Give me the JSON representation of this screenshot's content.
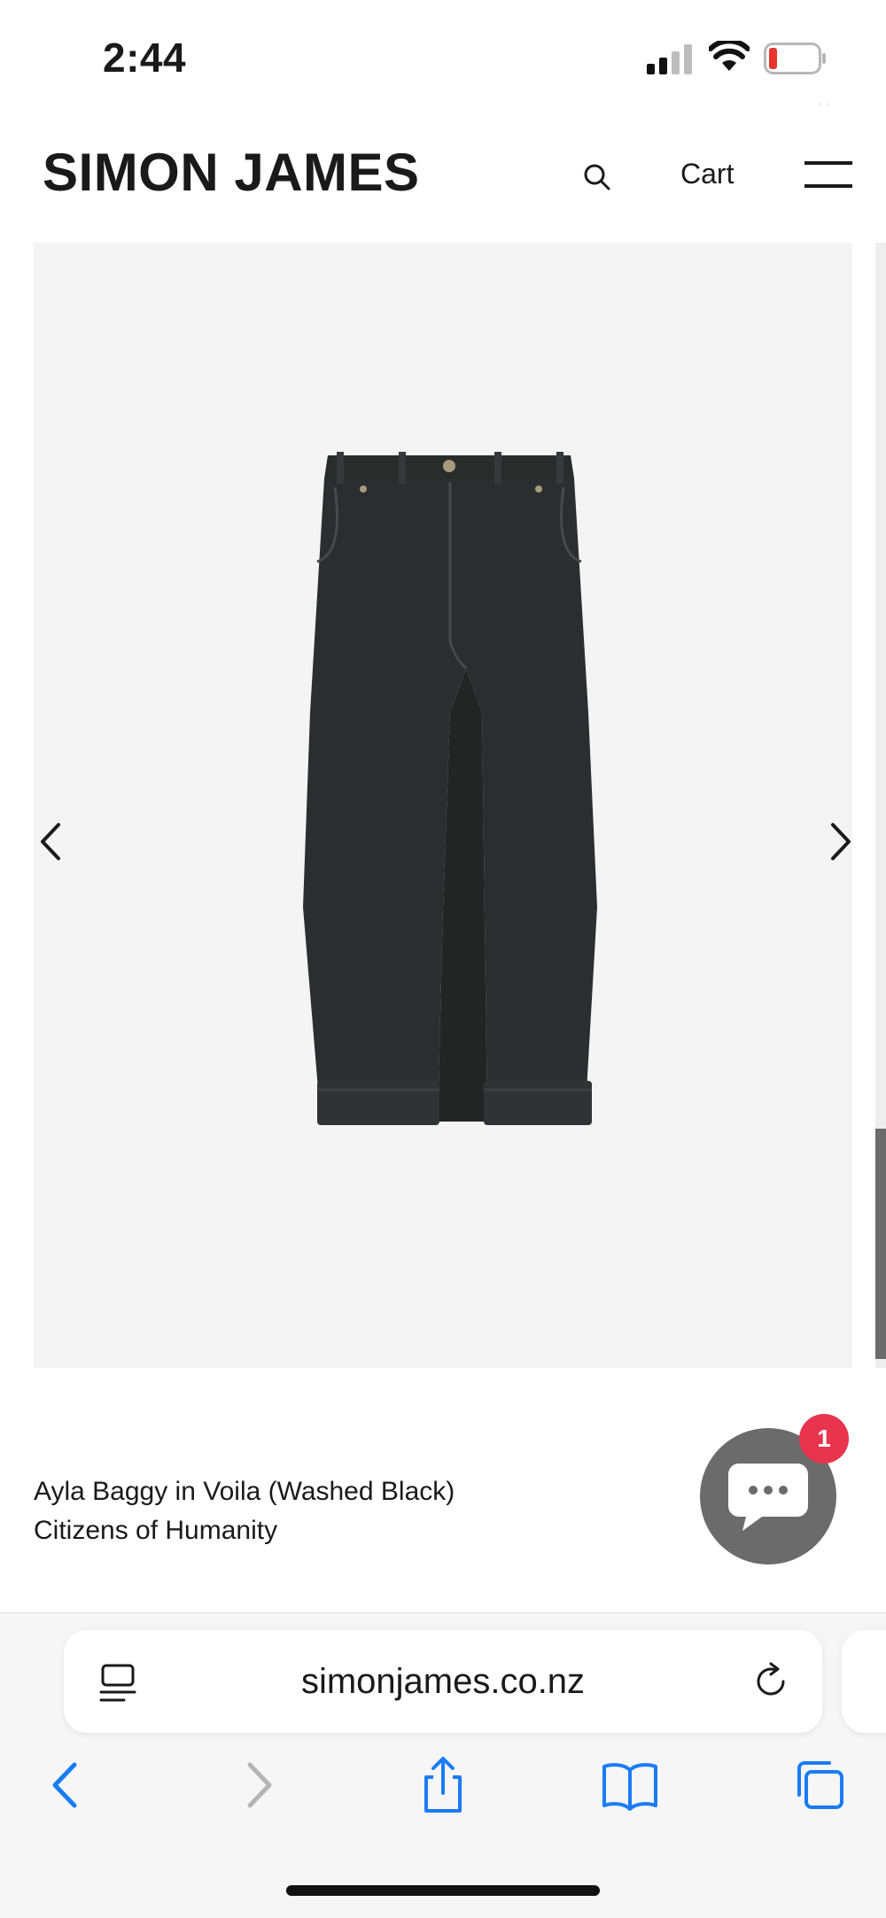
{
  "status_bar": {
    "time": "2:44",
    "icons": [
      "signal-icon",
      "wifi-icon",
      "battery-low-icon"
    ],
    "battery_color": "#e8342c"
  },
  "header": {
    "brand": "SIMON JAMES",
    "search_icon": "search-icon",
    "cart_label": "Cart",
    "menu_icon": "hamburger-menu-icon"
  },
  "gallery": {
    "background": "#f4f4f4",
    "prev_icon": "chevron-left-icon",
    "next_icon": "chevron-right-icon",
    "image": "black-wide-leg-jeans-image"
  },
  "product": {
    "title": "Ayla Baggy in Voila (Washed Black)",
    "brand": "Citizens of Humanity"
  },
  "chat": {
    "icon": "chat-bubble-icon",
    "badge_count": "1",
    "badge_color": "#e8344d",
    "button_color": "#6b6b6b"
  },
  "browser": {
    "url": "simonjames.co.nz",
    "reader_icon": "page-menu-icon",
    "reload_icon": "reload-icon",
    "toolbar": [
      "back-icon",
      "forward-icon",
      "share-icon",
      "bookmarks-icon",
      "tabs-icon"
    ],
    "accent": "#1a7cf5"
  }
}
